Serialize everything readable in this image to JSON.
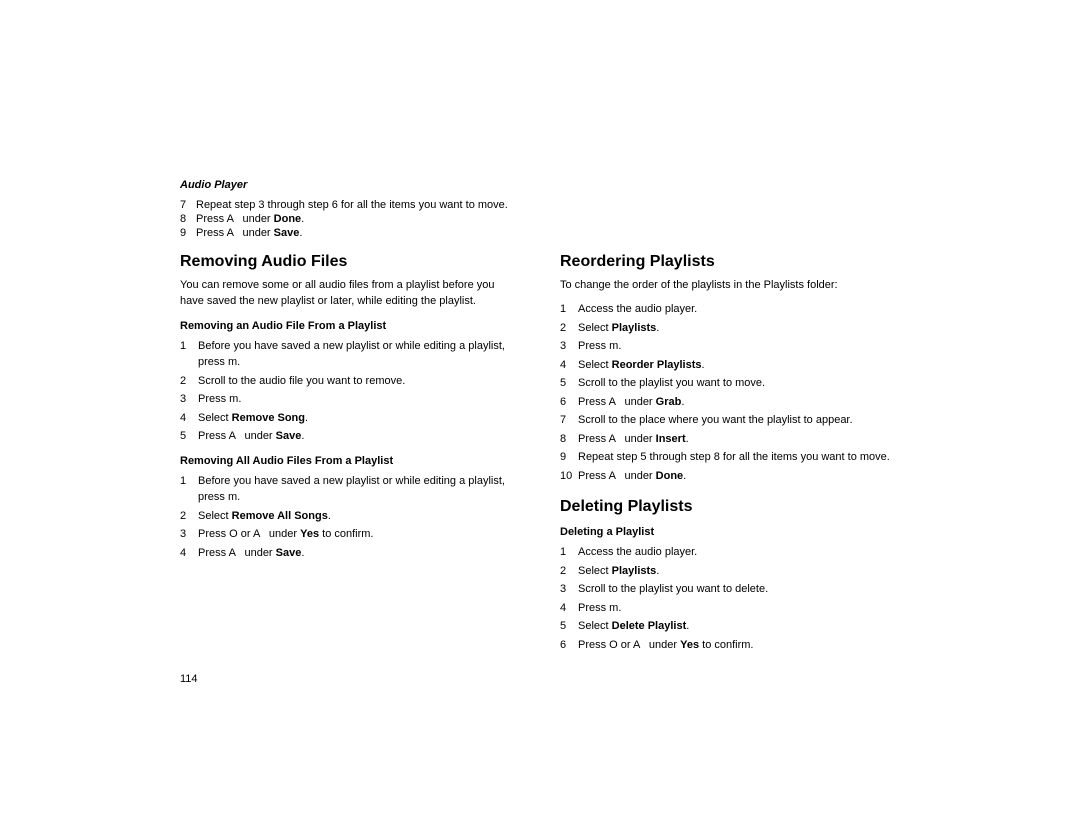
{
  "page": {
    "number": "114",
    "header": {
      "label": "Audio Player"
    },
    "intro": {
      "steps": [
        {
          "num": "7",
          "text": "Repeat step 3 through step 6 for all the items you want to move."
        },
        {
          "num": "8",
          "text": "Press A  under Done."
        },
        {
          "num": "9",
          "text": "Press A  under Save."
        }
      ]
    },
    "left": {
      "section1": {
        "title": "Removing Audio Files",
        "description": "You can remove some or all audio files from a playlist before you have saved the new playlist or later, while editing the playlist.",
        "subsection1": {
          "title": "Removing an Audio File From a Playlist",
          "steps": [
            {
              "num": "1",
              "text": "Before you have saved a new playlist or while editing a playlist, press m."
            },
            {
              "num": "2",
              "text": "Scroll to the audio file you want to remove."
            },
            {
              "num": "3",
              "text": "Press m."
            },
            {
              "num": "4",
              "text": "Select Remove Song."
            },
            {
              "num": "5",
              "text": "Press A  under Save."
            }
          ]
        },
        "subsection2": {
          "title": "Removing All Audio Files From a Playlist",
          "steps": [
            {
              "num": "1",
              "text": "Before you have saved a new playlist or while editing a playlist, press m."
            },
            {
              "num": "2",
              "text": "Select Remove All Songs."
            },
            {
              "num": "3",
              "text": "Press O or A  under Yes to confirm."
            },
            {
              "num": "4",
              "text": "Press A  under Save."
            }
          ]
        }
      }
    },
    "right": {
      "section1": {
        "title": "Reordering Playlists",
        "description": "To change the order of the playlists in the Playlists folder:",
        "steps": [
          {
            "num": "1",
            "text": "Access the audio player."
          },
          {
            "num": "2",
            "text": "Select Playlists."
          },
          {
            "num": "3",
            "text": "Press m."
          },
          {
            "num": "4",
            "text": "Select Reorder Playlists."
          },
          {
            "num": "5",
            "text": "Scroll to the playlist you want to move."
          },
          {
            "num": "6",
            "text": "Press A  under Grab."
          },
          {
            "num": "7",
            "text": "Scroll to the place where you want the playlist to appear."
          },
          {
            "num": "8",
            "text": "Press A  under Insert."
          },
          {
            "num": "9",
            "text": "Repeat step 5 through step 8 for all the items you want to move."
          },
          {
            "num": "10",
            "text": "Press A  under Done."
          }
        ]
      },
      "section2": {
        "title": "Deleting Playlists",
        "subsection1": {
          "title": "Deleting a Playlist",
          "steps": [
            {
              "num": "1",
              "text": "Access the audio player."
            },
            {
              "num": "2",
              "text": "Select Playlists."
            },
            {
              "num": "3",
              "text": "Scroll to the playlist you want to delete."
            },
            {
              "num": "4",
              "text": "Press m."
            },
            {
              "num": "5",
              "text": "Select Delete Playlist."
            },
            {
              "num": "6",
              "text": "Press O or A  under Yes to confirm."
            }
          ]
        }
      }
    }
  }
}
